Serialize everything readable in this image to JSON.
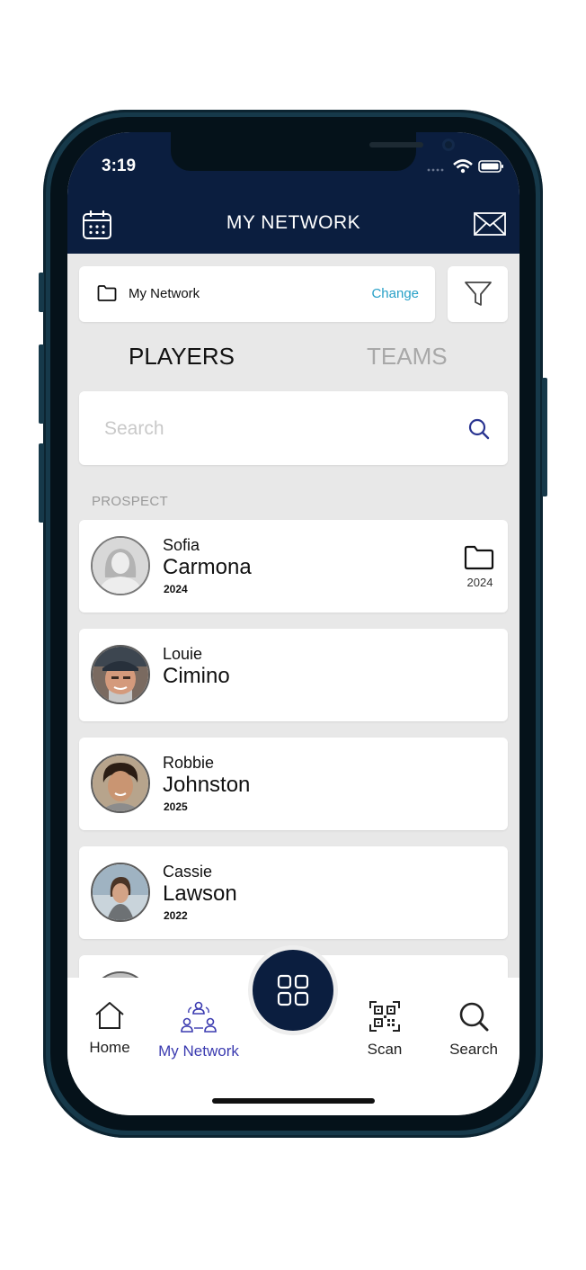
{
  "status": {
    "time": "3:19"
  },
  "header": {
    "title": "MY NETWORK",
    "calendar_icon": "calendar-icon",
    "mail_icon": "mail-icon"
  },
  "network_selector": {
    "label": "My Network",
    "change_label": "Change"
  },
  "tabs": [
    {
      "label": "PLAYERS",
      "active": true
    },
    {
      "label": "TEAMS",
      "active": false
    }
  ],
  "search": {
    "placeholder": "Search"
  },
  "section": {
    "label": "PROSPECT"
  },
  "players": [
    {
      "first": "Sofia",
      "last": "Carmona",
      "year": "2024",
      "folder_year": "2024"
    },
    {
      "first": "Louie",
      "last": "Cimino",
      "year": ""
    },
    {
      "first": "Robbie",
      "last": "Johnston",
      "year": "2025"
    },
    {
      "first": "Cassie",
      "last": "Lawson",
      "year": "2022"
    }
  ],
  "nav": {
    "home": "Home",
    "my_network": "My Network",
    "scan": "Scan",
    "search": "Search"
  },
  "colors": {
    "header_bg": "#0b1e3f",
    "accent_link": "#27a0c7",
    "active_nav": "#3b3bb0",
    "frame": "#16394a"
  }
}
